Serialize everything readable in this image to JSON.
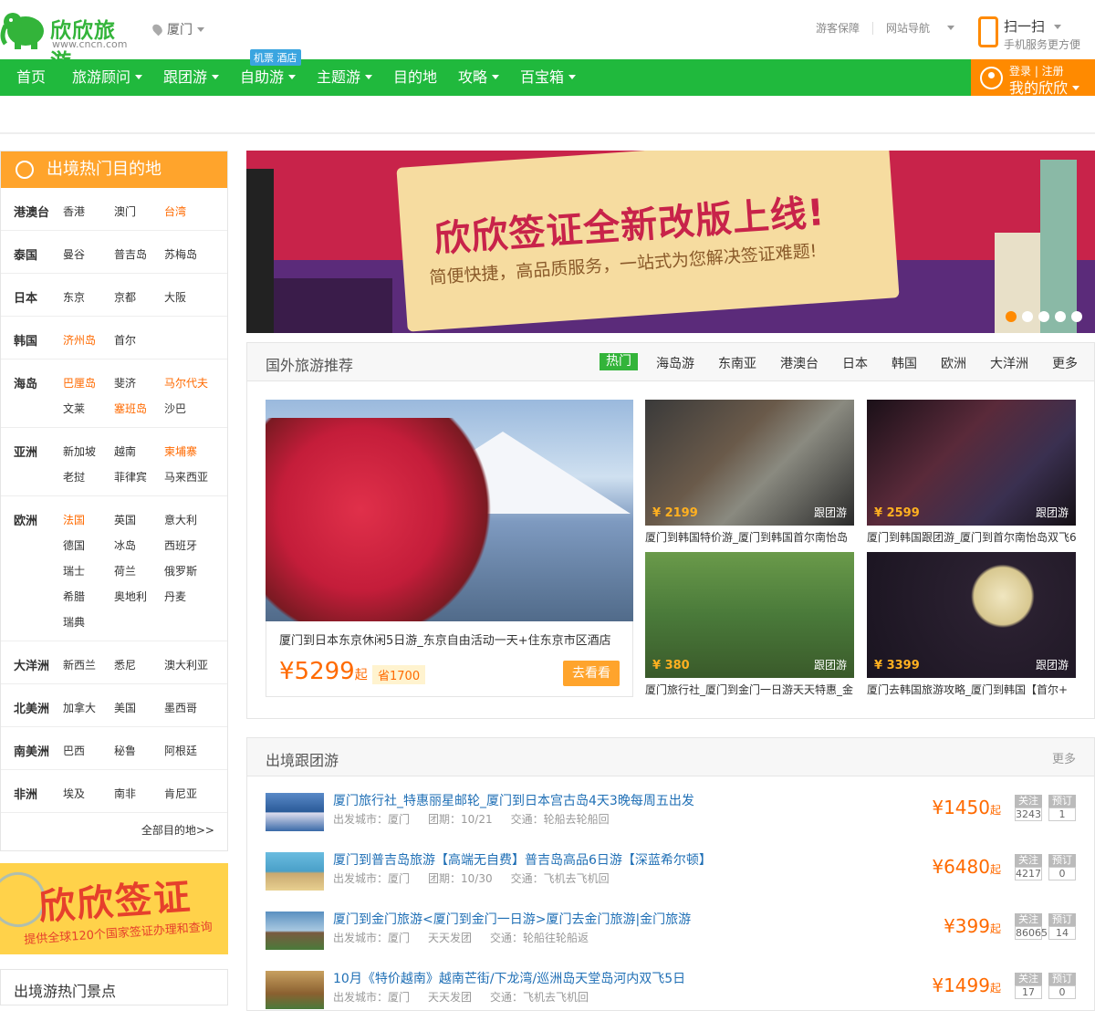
{
  "header": {
    "brand": "欣欣旅游",
    "url": "www.cncn.com",
    "city": "厦门",
    "links": [
      "游客保障",
      "网站导航"
    ],
    "scan_title": "扫一扫",
    "scan_sub": "手机服务更方便"
  },
  "nav": {
    "items": [
      "首页",
      "旅游顾问",
      "跟团游",
      "自助游",
      "主题游",
      "目的地",
      "攻略",
      "百宝箱"
    ],
    "badge": "机票 酒店",
    "login": "登录 | 注册",
    "mine": "我的欣欣"
  },
  "left": {
    "title": "出境热门目的地",
    "regions": [
      {
        "name": "港澳台",
        "places": [
          "香港",
          "澳门",
          "台湾"
        ]
      },
      {
        "name": "泰国",
        "places": [
          "曼谷",
          "普吉岛",
          "苏梅岛"
        ]
      },
      {
        "name": "日本",
        "places": [
          "东京",
          "京都",
          "大阪"
        ]
      },
      {
        "name": "韩国",
        "places": [
          "济州岛",
          "首尔"
        ]
      },
      {
        "name": "海岛",
        "places": [
          "巴厘岛",
          "斐济",
          "马尔代夫",
          "文莱",
          "塞班岛",
          "沙巴"
        ]
      },
      {
        "name": "亚洲",
        "places": [
          "新加坡",
          "越南",
          "柬埔寨",
          "老挝",
          "菲律宾",
          "马来西亚"
        ]
      },
      {
        "name": "欧洲",
        "places": [
          "法国",
          "英国",
          "意大利",
          "德国",
          "冰岛",
          "西班牙",
          "瑞士",
          "荷兰",
          "俄罗斯",
          "希腊",
          "奥地利",
          "丹麦",
          "瑞典"
        ]
      },
      {
        "name": "大洋洲",
        "places": [
          "新西兰",
          "悉尼",
          "澳大利亚"
        ]
      },
      {
        "name": "北美洲",
        "places": [
          "加拿大",
          "美国",
          "墨西哥"
        ]
      },
      {
        "name": "南美洲",
        "places": [
          "巴西",
          "秘鲁",
          "阿根廷"
        ]
      },
      {
        "name": "非洲",
        "places": [
          "埃及",
          "南非",
          "肯尼亚"
        ]
      }
    ],
    "all": "全部目的地>>",
    "visa_title": "欣欣签证",
    "visa_sub": "提供全球120个国家签证办理和查询",
    "hotspots_title": "出境游热门景点"
  },
  "banner": {
    "title": "欣欣签证全新改版上线!",
    "subtitle": "简便快捷，高品质服务，一站式为您解决签证难题!"
  },
  "recommend": {
    "title": "国外旅游推荐",
    "tabs": [
      "热门",
      "海岛游",
      "东南亚",
      "港澳台",
      "日本",
      "韩国",
      "欧洲",
      "大洋洲",
      "更多"
    ],
    "feature": {
      "title": "厦门到日本东京休闲5日游_东京自由活动一天+住东京市区酒店",
      "price": "¥5299",
      "price_suffix": "起",
      "save": "省1700",
      "button": "去看看"
    },
    "items": [
      {
        "price": "¥ 2199",
        "tag": "跟团游",
        "title": "厦门到韩国特价游_厦门到韩国首尔南怡岛"
      },
      {
        "price": "¥ 2599",
        "tag": "跟团游",
        "title": "厦门到韩国跟团游_厦门到首尔南怡岛双飞6"
      },
      {
        "price": "¥ 380",
        "tag": "跟团游",
        "title": "厦门旅行社_厦门到金门一日游天天特惠_金"
      },
      {
        "price": "¥ 3399",
        "tag": "跟团游",
        "title": "厦门去韩国旅游攻略_厦门到韩国【首尔+"
      }
    ]
  },
  "group": {
    "title": "出境跟团游",
    "more": "更多",
    "follow_label": "关注",
    "book_label": "预订",
    "tours": [
      {
        "title": "厦门旅行社_特惠丽星邮轮_厦门到日本宫古岛4天3晚每周五出发",
        "city": "出发城市：厦门",
        "date": "团期：10/21",
        "traffic": "交通：轮船去轮船回",
        "price": "¥1450",
        "follow": "3243",
        "book": "1"
      },
      {
        "title": "厦门到普吉岛旅游【高端无自费】普吉岛高品6日游【深蓝希尔顿】",
        "city": "出发城市：厦门",
        "date": "团期：10/30",
        "traffic": "交通：飞机去飞机回",
        "price": "¥6480",
        "follow": "4217",
        "book": "0"
      },
      {
        "title": "厦门到金门旅游<厦门到金门一日游>厦门去金门旅游|金门旅游",
        "city": "出发城市：厦门",
        "date": "天天发团",
        "traffic": "交通：轮船往轮船返",
        "price": "¥399",
        "follow": "86065",
        "book": "14"
      },
      {
        "title": "10月《特价越南》越南芒街/下龙湾/巡洲岛天堂岛河内双飞5日",
        "city": "出发城市：厦门",
        "date": "天天发团",
        "traffic": "交通：飞机去飞机回",
        "price": "¥1499",
        "follow": "17",
        "book": "0"
      }
    ],
    "price_suffix": "起"
  }
}
